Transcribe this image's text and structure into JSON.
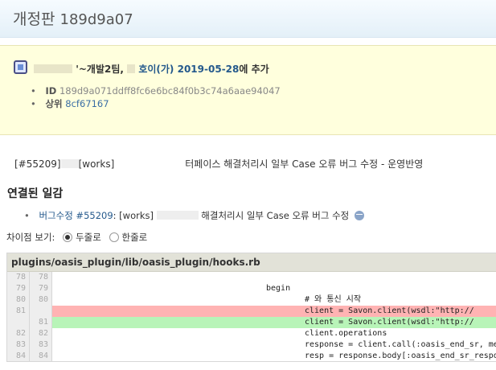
{
  "header": {
    "title_prefix": "개정판",
    "revision": "189d9a07"
  },
  "author": {
    "team_text": "'~개발2팀,",
    "name": "호이(가)",
    "date": "2019-05-28",
    "suffix": "에 추가"
  },
  "meta": {
    "id_label": "ID",
    "id_value": "189d9a071ddff8fc6e6bc84f0b3c74a6aae94047",
    "parent_label": "상위",
    "parent_value": "8cf67167"
  },
  "commit": {
    "issue_ref": "[#55209]",
    "tag": "[works]",
    "message": "터페이스 해결처리시 일부 Case 오류 버그 수정 - 운영반영"
  },
  "related": {
    "title": "연결된 일감",
    "items": [
      {
        "link": "버그수정 #55209",
        "text": ": [works]",
        "rest": "해결처리시 일부 Case 오류 버그 수정"
      }
    ]
  },
  "view_options": {
    "label": "차이점 보기:",
    "option1": "두줄로",
    "option2": "한줄로",
    "selected": "option1"
  },
  "file": {
    "path": "plugins/oasis_plugin/lib/oasis_plugin/hooks.rb",
    "lines": [
      {
        "old": "78",
        "new": "78",
        "type": "ctx",
        "indent": 0,
        "code": ""
      },
      {
        "old": "79",
        "new": "79",
        "type": "ctx",
        "indent": 1,
        "code": "begin"
      },
      {
        "old": "80",
        "new": "80",
        "type": "ctx",
        "indent": 2,
        "code": "# 와 통신 시작"
      },
      {
        "old": "81",
        "new": "",
        "type": "del",
        "indent": 2,
        "code": "client = Savon.client(wsdl:\"http://            net"
      },
      {
        "old": "",
        "new": "81",
        "type": "add",
        "indent": 2,
        "code": "client = Savon.client(wsdl:\"http://        .net/pr"
      },
      {
        "old": "82",
        "new": "82",
        "type": "ctx",
        "indent": 2,
        "code": "client.operations"
      },
      {
        "old": "83",
        "new": "83",
        "type": "ctx",
        "indent": 2,
        "code": "response = client.call(:oasis_end_sr, message: {\"C"
      },
      {
        "old": "84",
        "new": "84",
        "type": "ctx",
        "indent": 2,
        "code": "resp = response.body[:oasis_end_sr_response][:oasi"
      }
    ]
  },
  "colors": {
    "deleted_bg": "#ffb3b3",
    "added_bg": "#b8f4b8",
    "link": "#24598c",
    "info_box_bg": "#ffffdd"
  }
}
